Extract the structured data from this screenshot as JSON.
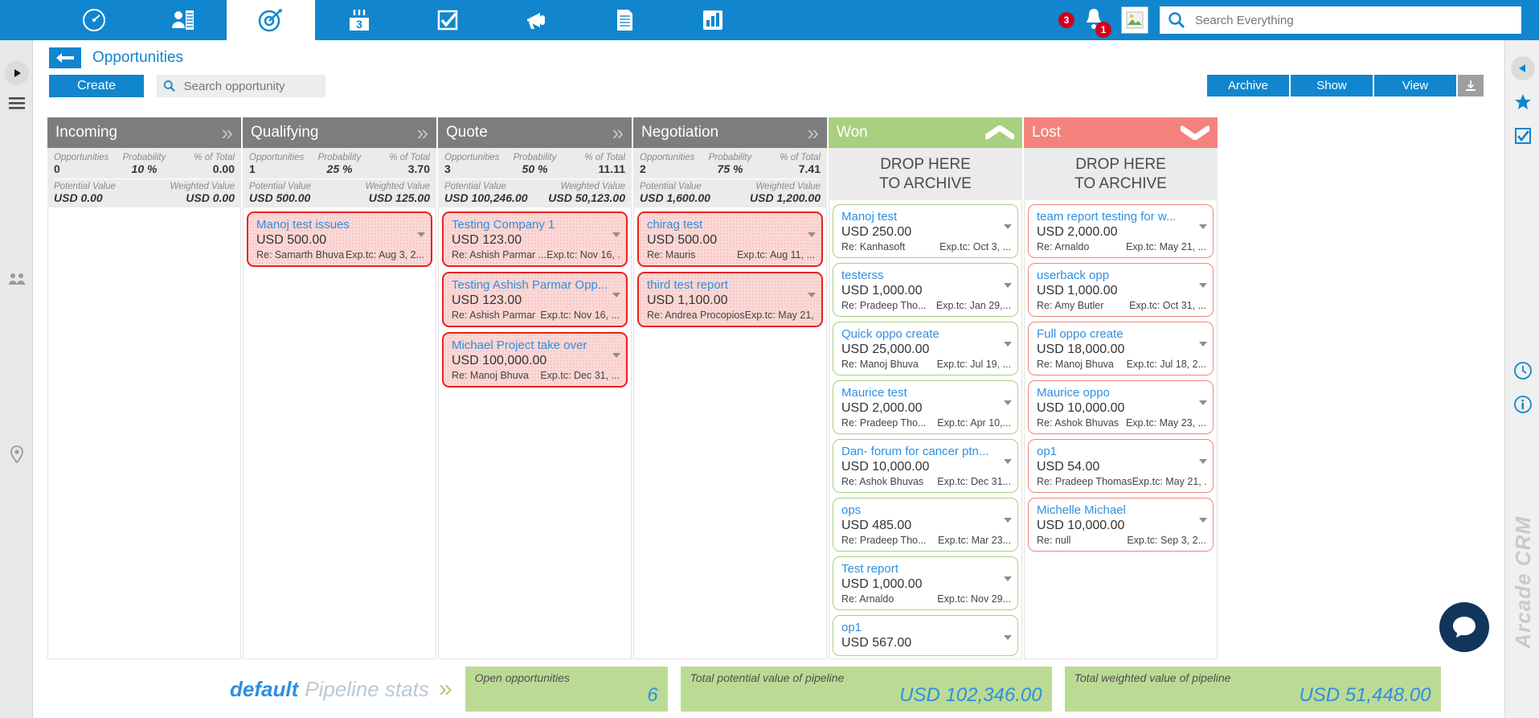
{
  "topnav": {
    "tabs": [
      {
        "name": "dashboard",
        "icon": "gauge-icon",
        "active": false
      },
      {
        "name": "contacts",
        "icon": "contacts-icon",
        "active": false
      },
      {
        "name": "opportunities",
        "icon": "target-icon",
        "active": true
      },
      {
        "name": "calendar",
        "icon": "calendar-icon",
        "active": false
      },
      {
        "name": "tasks",
        "icon": "checkbox-icon",
        "active": false
      },
      {
        "name": "campaigns",
        "icon": "megaphone-icon",
        "active": false
      },
      {
        "name": "documents",
        "icon": "document-icon",
        "active": false
      },
      {
        "name": "reports",
        "icon": "chart-bar-icon",
        "active": false
      }
    ],
    "alert_count": "3",
    "notification_count": "1",
    "search_placeholder": "Search Everything"
  },
  "header": {
    "breadcrumb": "Opportunities",
    "create_label": "Create",
    "search_placeholder": "Search opportunity",
    "archive_label": "Archive",
    "show_label": "Show",
    "view_label": "View"
  },
  "columns": [
    {
      "title": "Incoming",
      "type": "stage",
      "stats": {
        "opportunities_label": "Opportunities",
        "opportunities": "0",
        "probability_label": "Probability",
        "probability": "10 %",
        "percent_label": "% of Total",
        "percent": "0.00",
        "potential_label": "Potential Value",
        "potential": "USD 0.00",
        "weighted_label": "Weighted Value",
        "weighted": "USD 0.00"
      },
      "cards": []
    },
    {
      "title": "Qualifying",
      "type": "stage",
      "stats": {
        "opportunities_label": "Opportunities",
        "opportunities": "1",
        "probability_label": "Probability",
        "probability": "25 %",
        "percent_label": "% of Total",
        "percent": "3.70",
        "potential_label": "Potential Value",
        "potential": "USD 500.00",
        "weighted_label": "Weighted Value",
        "weighted": "USD 125.00"
      },
      "cards": [
        {
          "title": "Manoj test issues",
          "amount": "USD 500.00",
          "re": "Re: Samarth Bhuva",
          "exp": "Exp.tc: Aug 3, 2...",
          "style": "pink"
        }
      ]
    },
    {
      "title": "Quote",
      "type": "stage",
      "stats": {
        "opportunities_label": "Opportunities",
        "opportunities": "3",
        "probability_label": "Probability",
        "probability": "50 %",
        "percent_label": "% of Total",
        "percent": "11.11",
        "potential_label": "Potential Value",
        "potential": "USD 100,246.00",
        "weighted_label": "Weighted Value",
        "weighted": "USD 50,123.00"
      },
      "cards": [
        {
          "title": "Testing Company 1",
          "amount": "USD 123.00",
          "re": "Re: Ashish Parmar ...",
          "exp": "Exp.tc: Nov 16, ...",
          "style": "pink"
        },
        {
          "title": "Testing Ashish Parmar Opp...",
          "amount": "USD 123.00",
          "re": "Re: Ashish Parmar",
          "exp": "Exp.tc: Nov 16, ...",
          "style": "pink"
        },
        {
          "title": "Michael Project take over",
          "amount": "USD 100,000.00",
          "re": "Re: Manoj Bhuva",
          "exp": "Exp.tc: Dec 31, ...",
          "style": "pink"
        }
      ]
    },
    {
      "title": "Negotiation",
      "type": "stage",
      "stats": {
        "opportunities_label": "Opportunities",
        "opportunities": "2",
        "probability_label": "Probability",
        "probability": "75 %",
        "percent_label": "% of Total",
        "percent": "7.41",
        "potential_label": "Potential Value",
        "potential": "USD 1,600.00",
        "weighted_label": "Weighted Value",
        "weighted": "USD 1,200.00"
      },
      "cards": [
        {
          "title": "chirag test",
          "amount": "USD 500.00",
          "re": "Re: Mauris",
          "exp": "Exp.tc: Aug 11, ...",
          "style": "pink"
        },
        {
          "title": "third test report",
          "amount": "USD 1,100.00",
          "re": "Re: Andrea Procopios",
          "exp": "Exp.tc: May 21, ...",
          "style": "pink"
        }
      ]
    },
    {
      "title": "Won",
      "type": "won",
      "drop_line1": "DROP HERE",
      "drop_line2": "TO ARCHIVE",
      "cards": [
        {
          "title": "Manoj test",
          "amount": "USD 250.00",
          "re": "Re: Kanhasoft",
          "exp": "Exp.tc: Oct 3, ...",
          "style": "won"
        },
        {
          "title": "testerss",
          "amount": "USD 1,000.00",
          "re": "Re: Pradeep Tho...",
          "exp": "Exp.tc: Jan 29,...",
          "style": "won"
        },
        {
          "title": "Quick oppo create",
          "amount": "USD 25,000.00",
          "re": "Re: Manoj Bhuva",
          "exp": "Exp.tc: Jul 19, ...",
          "style": "won"
        },
        {
          "title": "Maurice test",
          "amount": "USD 2,000.00",
          "re": "Re: Pradeep Tho...",
          "exp": "Exp.tc: Apr 10,...",
          "style": "won"
        },
        {
          "title": "Dan- forum for cancer ptn...",
          "amount": "USD 10,000.00",
          "re": "Re: Ashok Bhuvas",
          "exp": "Exp.tc: Dec 31...",
          "style": "won"
        },
        {
          "title": "ops",
          "amount": "USD 485.00",
          "re": "Re: Pradeep Tho...",
          "exp": "Exp.tc: Mar 23...",
          "style": "won"
        },
        {
          "title": "Test report",
          "amount": "USD 1,000.00",
          "re": "Re: Arnaldo",
          "exp": "Exp.tc: Nov 29...",
          "style": "won"
        },
        {
          "title": "op1",
          "amount": "USD 567.00",
          "re": "",
          "exp": "",
          "style": "won"
        }
      ]
    },
    {
      "title": "Lost",
      "type": "lost",
      "drop_line1": "DROP HERE",
      "drop_line2": "TO ARCHIVE",
      "cards": [
        {
          "title": "team report testing for w...",
          "amount": "USD 2,000.00",
          "re": "Re: Arnaldo",
          "exp": "Exp.tc: May 21, ...",
          "style": "lost"
        },
        {
          "title": "userback opp",
          "amount": "USD 1,000.00",
          "re": "Re: Amy Butler",
          "exp": "Exp.tc: Oct 31, ...",
          "style": "lost"
        },
        {
          "title": "Full oppo create",
          "amount": "USD 18,000.00",
          "re": "Re: Manoj Bhuva",
          "exp": "Exp.tc: Jul 18, 2...",
          "style": "lost"
        },
        {
          "title": "Maurice oppo",
          "amount": "USD 10,000.00",
          "re": "Re: Ashok Bhuvas",
          "exp": "Exp.tc: May 23, ...",
          "style": "lost"
        },
        {
          "title": "op1",
          "amount": "USD 54.00",
          "re": "Re: Pradeep Thomas",
          "exp": "Exp.tc: May 21, ...",
          "style": "lost"
        },
        {
          "title": "Michelle Michael",
          "amount": "USD 10,000.00",
          "re": "Re: null",
          "exp": "Exp.tc: Sep 3, 2...",
          "style": "lost"
        }
      ]
    }
  ],
  "footer": {
    "pipeline_default": "default",
    "pipeline_stats": "Pipeline stats",
    "cards": [
      {
        "label": "Open opportunities",
        "value": "6"
      },
      {
        "label": "Total potential value of pipeline",
        "value": "USD 102,346.00"
      },
      {
        "label": "Total weighted value of pipeline",
        "value": "USD 51,448.00"
      }
    ]
  },
  "brand": "Arcade CRM"
}
